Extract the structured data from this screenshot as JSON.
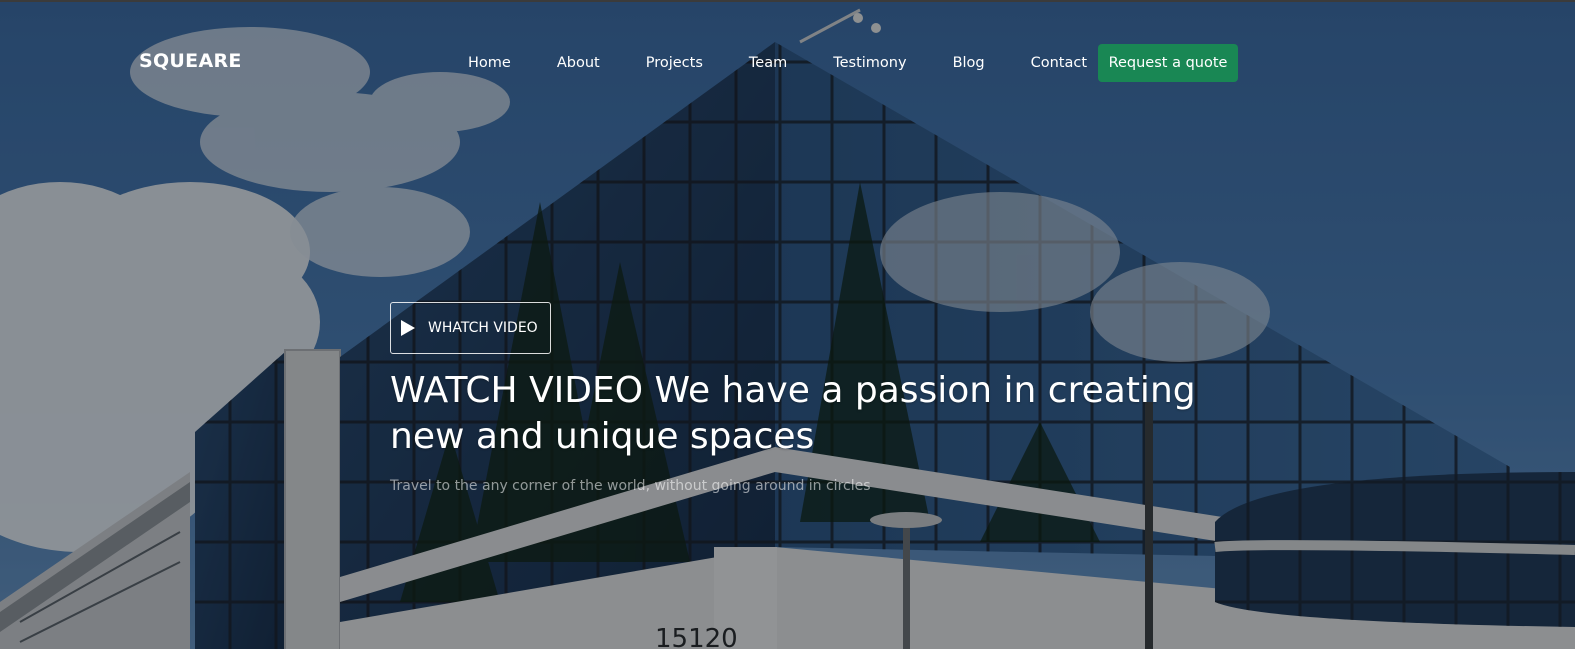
{
  "brand": "SQUEARE",
  "nav": {
    "links": [
      "Home",
      "About",
      "Projects",
      "Team",
      "Testimony",
      "Blog",
      "Contact"
    ],
    "cta": "Request a quote"
  },
  "hero": {
    "watch_button": "WHATCH VIDEO",
    "title": "WATCH VIDEO We have a passion in creating new and unique spaces",
    "subtitle": "Travel to the any corner of the world, without going around in circles",
    "building_number": "15120"
  },
  "colors": {
    "accent": "#198754",
    "sky": "#3d6fa8",
    "overlay": "rgba(0,0,0,0.38)"
  },
  "icons": {
    "watch_button": "play-icon"
  }
}
